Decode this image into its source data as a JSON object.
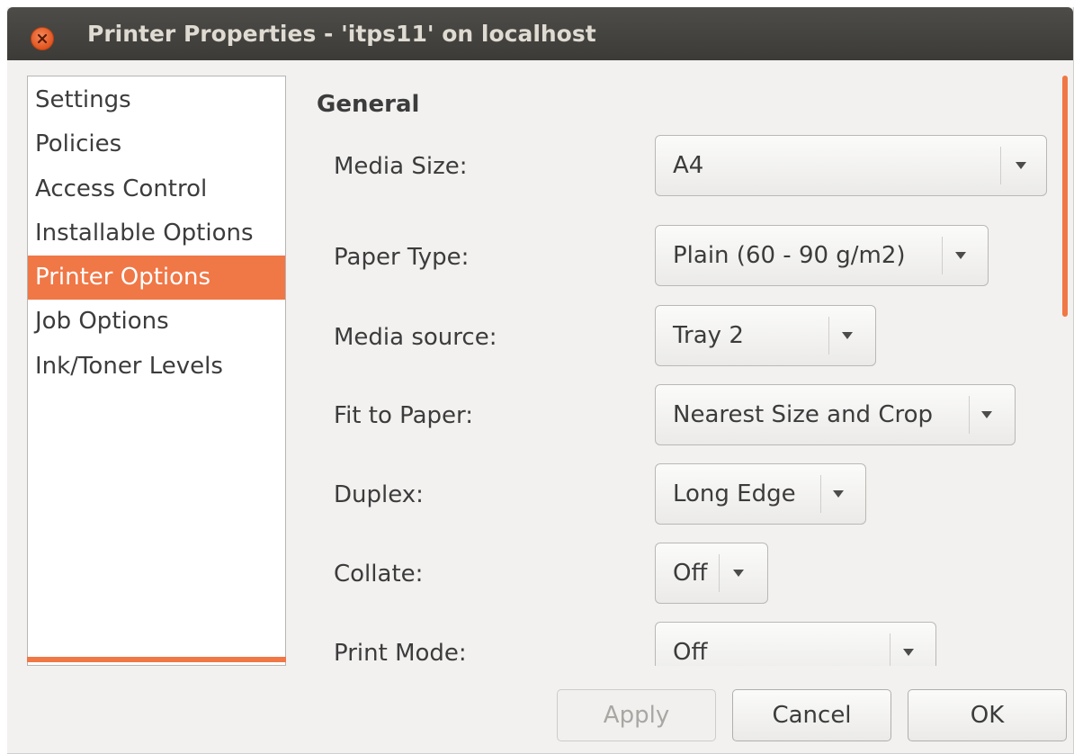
{
  "window": {
    "title": "Printer Properties - 'itps11' on localhost"
  },
  "sidebar": {
    "items": [
      {
        "label": "Settings",
        "selected": false
      },
      {
        "label": "Policies",
        "selected": false
      },
      {
        "label": "Access Control",
        "selected": false
      },
      {
        "label": "Installable Options",
        "selected": false
      },
      {
        "label": "Printer Options",
        "selected": true
      },
      {
        "label": "Job Options",
        "selected": false
      },
      {
        "label": "Ink/Toner Levels",
        "selected": false
      }
    ]
  },
  "main": {
    "section_heading": "General",
    "options": [
      {
        "label": "Media Size:",
        "value": "A4"
      },
      {
        "label": "Paper Type:",
        "value": "Plain (60 - 90 g/m2)"
      },
      {
        "label": "Media source:",
        "value": "Tray 2"
      },
      {
        "label": "Fit to Paper:",
        "value": "Nearest Size and Crop"
      },
      {
        "label": "Duplex:",
        "value": "Long Edge"
      },
      {
        "label": "Collate:",
        "value": "Off"
      },
      {
        "label": "Print Mode:",
        "value": "Off"
      }
    ]
  },
  "buttons": {
    "apply": {
      "label": "Apply",
      "enabled": false
    },
    "cancel": {
      "label": "Cancel",
      "enabled": true
    },
    "ok": {
      "label": "OK",
      "enabled": true
    }
  },
  "icons": {
    "close": "close-icon",
    "dropdown": "dropdown-arrow-icon"
  },
  "colors": {
    "accent": "#f07746",
    "titlebar": "#3c3b37",
    "window_bg": "#f2f1f0"
  }
}
